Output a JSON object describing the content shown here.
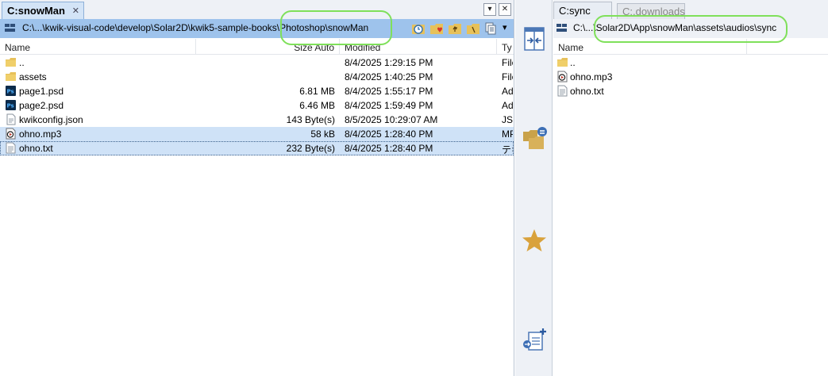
{
  "left": {
    "tab_label": "C:snowMan",
    "tab_close": "✕",
    "window_buttons": {
      "menu": "▾",
      "close": "✕"
    },
    "path": "C:\\...\\kwik-visual-code\\develop\\Solar2D\\kwik5-sample-books\\Photoshop\\snowMan",
    "toolbar_more": "▾",
    "columns": {
      "name": "Name",
      "size": "Size Auto",
      "modified": "Modified",
      "type": "Ty"
    },
    "rows": [
      {
        "icon": "folder-up-icon",
        "name": "..",
        "size": "",
        "modified": "8/4/2025 1:29:15 PM",
        "type": "File"
      },
      {
        "icon": "folder-icon",
        "name": "assets",
        "size": "",
        "modified": "8/4/2025 1:40:25 PM",
        "type": "File"
      },
      {
        "icon": "psd-file-icon",
        "name": "page1.psd",
        "size": "6.81 MB",
        "modified": "8/4/2025 1:55:17 PM",
        "type": "Ad"
      },
      {
        "icon": "psd-file-icon",
        "name": "page2.psd",
        "size": "6.46 MB",
        "modified": "8/4/2025 1:59:49 PM",
        "type": "Ad"
      },
      {
        "icon": "json-file-icon",
        "name": "kwikconfig.json",
        "size": "143 Byte(s)",
        "modified": "8/5/2025 10:29:07 AM",
        "type": "JSC"
      },
      {
        "icon": "audio-file-icon",
        "name": "ohno.mp3",
        "size": "58 kB",
        "modified": "8/4/2025 1:28:40 PM",
        "type": "MP"
      },
      {
        "icon": "text-file-icon",
        "name": "ohno.txt",
        "size": "232 Byte(s)",
        "modified": "8/4/2025 1:28:40 PM",
        "type": "テキ"
      }
    ]
  },
  "right": {
    "tab_active": "C:sync",
    "tab_inactive": "C:.downloads",
    "path": "C:\\...\\Solar2D\\App\\snowMan\\assets\\audios\\sync",
    "columns": {
      "name": "Name"
    },
    "rows": [
      {
        "icon": "folder-up-icon",
        "name": ".."
      },
      {
        "icon": "audio-file-icon",
        "name": "ohno.mp3"
      },
      {
        "icon": "text-file-icon",
        "name": "ohno.txt"
      }
    ]
  },
  "colors": {
    "highlight": "#7fe05a",
    "selection": "#cfe2f7",
    "pathbar": "#9ec3ec"
  }
}
